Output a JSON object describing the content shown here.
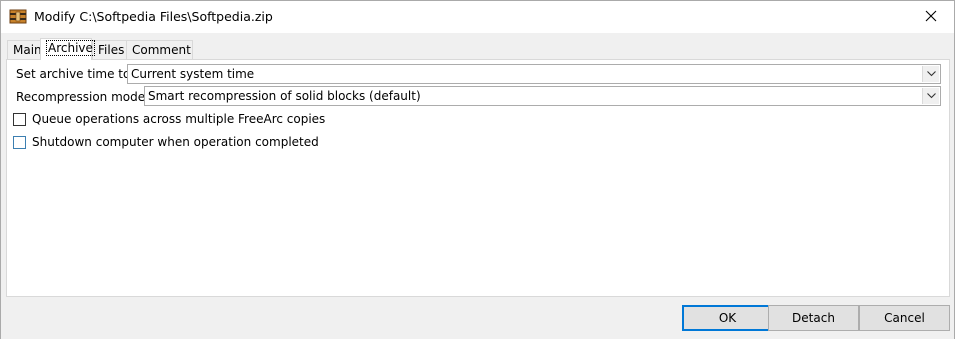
{
  "window": {
    "title": "Modify C:\\Softpedia Files\\Softpedia.zip"
  },
  "tabs": [
    {
      "label": "Main"
    },
    {
      "label": "Archive",
      "active": true
    },
    {
      "label": "Files"
    },
    {
      "label": "Comment"
    }
  ],
  "archive_time": {
    "label": "Set archive time to:",
    "value": "Current system time"
  },
  "recompression": {
    "label": "Recompression mode:",
    "value": "Smart recompression of solid blocks (default)"
  },
  "options": {
    "queue_label": "Queue operations across multiple FreeArc copies",
    "queue_checked": false,
    "shutdown_label": "Shutdown computer when operation completed",
    "shutdown_checked": false
  },
  "buttons": {
    "ok": "OK",
    "detach": "Detach",
    "cancel": "Cancel"
  },
  "icons": {
    "app": "archive-icon",
    "close": "close-icon",
    "dropdown": "chevron-down-icon"
  },
  "colors": {
    "accent": "#0078d7",
    "window_bg": "#f0f0f0",
    "panel_bg": "#ffffff"
  }
}
